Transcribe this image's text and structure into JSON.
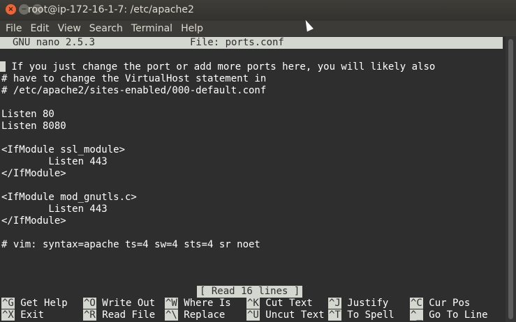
{
  "window": {
    "title": "root@ip-172-16-1-7: /etc/apache2",
    "close": "×",
    "minimize": "−",
    "maximize": "□"
  },
  "menu": [
    "File",
    "Edit",
    "View",
    "Search",
    "Terminal",
    "Help"
  ],
  "nano": {
    "version": "GNU nano 2.5.3",
    "file_label": "File: ports.conf"
  },
  "content_lines": [
    "# If you just change the port or add more ports here, you will likely also",
    "# have to change the VirtualHost statement in",
    "# /etc/apache2/sites-enabled/000-default.conf",
    "",
    "Listen 80",
    "Listen 8080",
    "",
    "<IfModule ssl_module>",
    "        Listen 443",
    "</IfModule>",
    "",
    "<IfModule mod_gnutls.c>",
    "        Listen 443",
    "</IfModule>",
    "",
    "# vim: syntax=apache ts=4 sw=4 sts=4 sr noet"
  ],
  "status_message": "[ Read 16 lines ]",
  "shortcuts": [
    {
      "key": "^G",
      "label": "Get Help"
    },
    {
      "key": "^O",
      "label": "Write Out"
    },
    {
      "key": "^W",
      "label": "Where Is"
    },
    {
      "key": "^K",
      "label": "Cut Text"
    },
    {
      "key": "^J",
      "label": "Justify"
    },
    {
      "key": "^C",
      "label": "Cur Pos"
    },
    {
      "key": "^X",
      "label": "Exit"
    },
    {
      "key": "^R",
      "label": "Read File"
    },
    {
      "key": "^\\",
      "label": "Replace"
    },
    {
      "key": "^U",
      "label": "Uncut Text"
    },
    {
      "key": "^T",
      "label": "To Spell"
    },
    {
      "key": "^_",
      "label": "Go To Line"
    }
  ]
}
